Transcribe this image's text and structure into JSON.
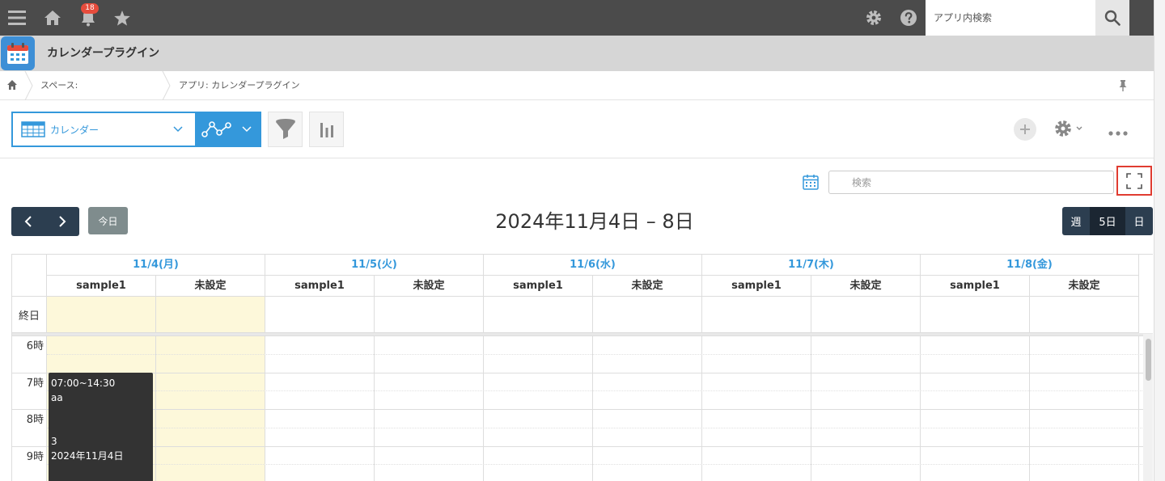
{
  "topbar": {
    "notification_count": "18",
    "search_placeholder": "アプリ内検索"
  },
  "app": {
    "title": "カレンダープラグイン"
  },
  "breadcrumb": {
    "space": "スペース:",
    "app": "アプリ: カレンダープラグイン"
  },
  "toolbar": {
    "view_name": "カレンダー"
  },
  "calendar": {
    "search_placeholder": "検索",
    "today_label": "今日",
    "range_title": "2024年11月4日 – 8日",
    "modes": [
      {
        "label": "週",
        "active": false
      },
      {
        "label": "5日",
        "active": true
      },
      {
        "label": "日",
        "active": false
      }
    ],
    "days": [
      {
        "label": "11/4(月)",
        "resources": [
          "sample1",
          "未設定"
        ]
      },
      {
        "label": "11/5(火)",
        "resources": [
          "sample1",
          "未設定"
        ]
      },
      {
        "label": "11/6(水)",
        "resources": [
          "sample1",
          "未設定"
        ]
      },
      {
        "label": "11/7(木)",
        "resources": [
          "sample1",
          "未設定"
        ]
      },
      {
        "label": "11/8(金)",
        "resources": [
          "sample1",
          "未設定"
        ]
      }
    ],
    "allday_label": "終日",
    "hours": [
      "6時",
      "7時",
      "8時",
      "9時"
    ],
    "event": {
      "time": "07:00~14:30",
      "title": "aa",
      "line3": "3",
      "date": "2024年11月4日"
    }
  },
  "colors": {
    "topbar": "#4b4b4b",
    "accent_blue": "#3498db",
    "today_highlight": "#fdf8da",
    "nav_dark": "#2c3e50",
    "event_bg": "#333333",
    "fullscreen_outline": "#e03c31"
  }
}
